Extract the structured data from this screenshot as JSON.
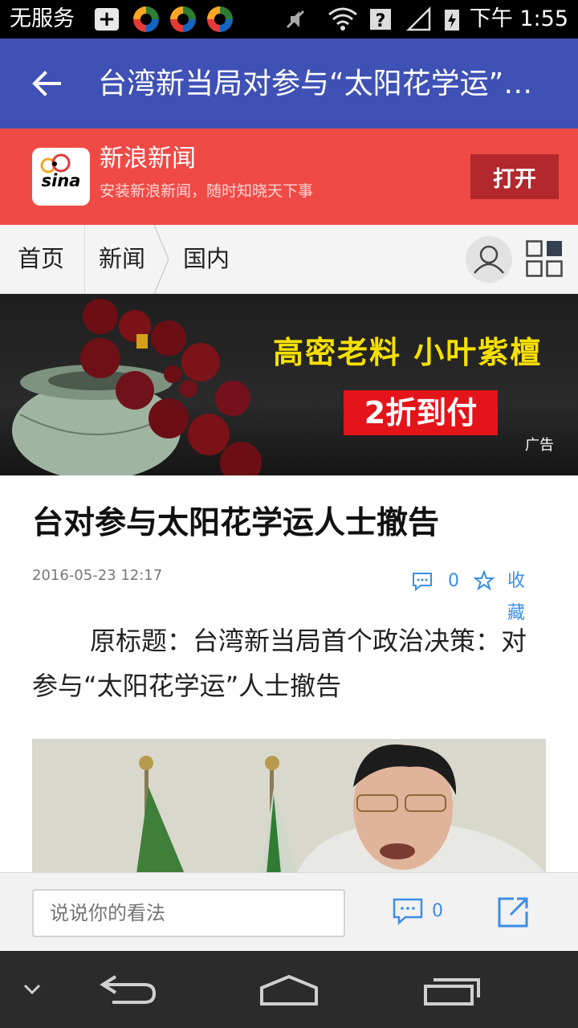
{
  "status_bar": {
    "carrier": "无服务",
    "time": "下午 1:55"
  },
  "title_bar": {
    "title": "台湾新当局对参与“太阳花学运”…",
    "back_icon": "arrow-left-icon"
  },
  "app_banner": {
    "logo_text": "sina",
    "app_name": "新浪新闻",
    "description": "安装新浪新闻，随时知晓天下事",
    "open_button": "打开",
    "background": "#f04a46"
  },
  "breadcrumb": {
    "items": [
      "首页",
      "新闻",
      "国内"
    ],
    "user_icon": "user-icon",
    "menu_icon": "grid-menu-icon"
  },
  "ad": {
    "headline": "高密老料  小叶紫檀",
    "price": "2折到付",
    "tag": "广告"
  },
  "article": {
    "headline": "台对参与太阳花学运人士撤告",
    "date": "2016-05-23 12:17",
    "comment_count": "0",
    "favorite_label": "收藏",
    "lead": "原标题：台湾新当局首个政治决策：对参与“太阳花学运”人士撤告"
  },
  "comment_bar": {
    "placeholder": "说说你的看法",
    "comment_count": "0",
    "share_icon": "share-icon"
  },
  "colors": {
    "title_bar": "#3f51b5",
    "accent": "#3b8ee6"
  }
}
